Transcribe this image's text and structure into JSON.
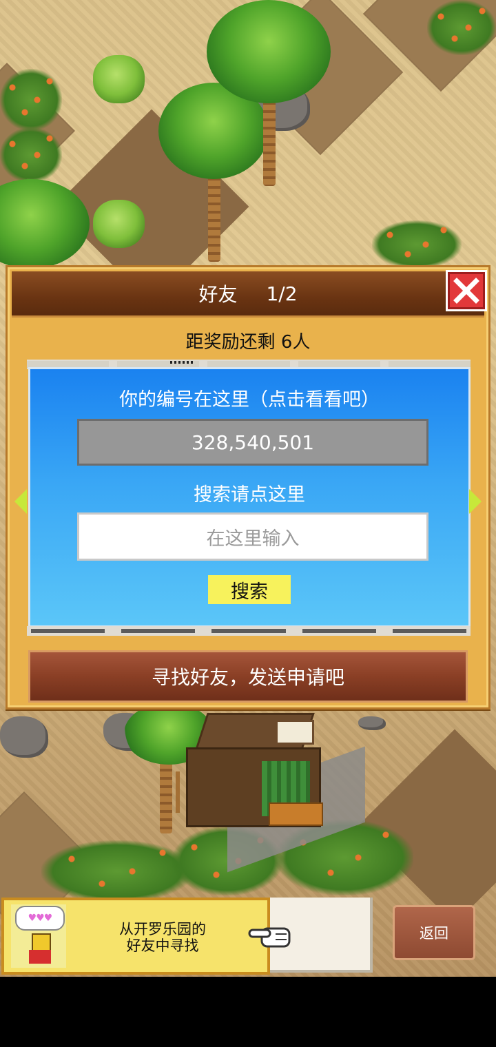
{
  "dialog": {
    "title": "好友",
    "page_indicator": "1/2",
    "reward_text": "距奖励还剩 6人",
    "id_label": "你的编号在这里（点击看看吧）",
    "player_id": "328,540,501",
    "search_label": "搜索请点这里",
    "search_placeholder": "在这里输入",
    "search_button": "搜索",
    "find_friends_button": "寻找好友，发送申请吧"
  },
  "bottom": {
    "hint_line1": "从开罗乐园的",
    "hint_line2": "好友中寻找",
    "hearts": "♥♥♥",
    "back_button": "返回"
  },
  "colors": {
    "panel_blue": "#1a82f0",
    "dialog_gold": "#e9b24c",
    "close_red": "#e2383a",
    "search_yellow": "#f7f25c"
  }
}
